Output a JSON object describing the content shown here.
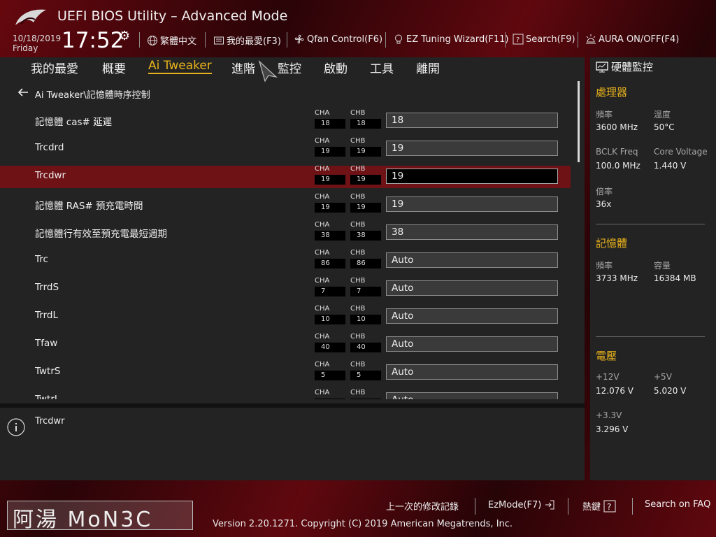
{
  "header": {
    "title": "UEFI BIOS Utility – Advanced Mode",
    "date": "10/18/2019",
    "day": "Friday",
    "time": "17:52",
    "toolbar": {
      "language": "繁體中文",
      "favorites": "我的最愛(F3)",
      "qfan": "Qfan Control(F6)",
      "ez_tuning": "EZ Tuning Wizard(F11)",
      "search": "Search(F9)",
      "aura": "AURA ON/OFF(F4)"
    }
  },
  "tabs": [
    "我的最愛",
    "概要",
    "Ai Tweaker",
    "進階",
    "監控",
    "啟動",
    "工具",
    "離開"
  ],
  "active_tab": "Ai Tweaker",
  "breadcrumb": "Ai Tweaker\\記憶體時序控制",
  "channel_labels": {
    "a": "CHA",
    "b": "CHB"
  },
  "settings": [
    {
      "label": "記憶體 cas# 延遲",
      "cha": "18",
      "chb": "18",
      "value": "18"
    },
    {
      "label": "Trcdrd",
      "cha": "19",
      "chb": "19",
      "value": "19"
    },
    {
      "label": "Trcdwr",
      "cha": "19",
      "chb": "19",
      "value": "19"
    },
    {
      "label": "記憶體 RAS# 預充電時間",
      "cha": "19",
      "chb": "19",
      "value": "19"
    },
    {
      "label": "記憶體行有效至預充電最短週期",
      "cha": "38",
      "chb": "38",
      "value": "38"
    },
    {
      "label": "Trc",
      "cha": "86",
      "chb": "86",
      "value": "Auto"
    },
    {
      "label": "TrrdS",
      "cha": "7",
      "chb": "7",
      "value": "Auto"
    },
    {
      "label": "TrrdL",
      "cha": "10",
      "chb": "10",
      "value": "Auto"
    },
    {
      "label": "Tfaw",
      "cha": "40",
      "chb": "40",
      "value": "Auto"
    },
    {
      "label": "TwtrS",
      "cha": "5",
      "chb": "5",
      "value": "Auto"
    },
    {
      "label": "TwtrL",
      "cha": "",
      "chb": "",
      "value": "Auto"
    }
  ],
  "selected_setting": "Trcdwr",
  "help_text": "Trcdwr",
  "hardware_monitor": {
    "title": "硬體監控",
    "cpu": {
      "title": "處理器",
      "freq_label": "頻率",
      "freq": "3600 MHz",
      "temp_label": "溫度",
      "temp": "50°C",
      "bclk_label": "BCLK Freq",
      "bclk": "100.0 MHz",
      "voltage_label": "Core Voltage",
      "voltage": "1.440 V",
      "ratio_label": "倍率",
      "ratio": "36x"
    },
    "memory": {
      "title": "記憶體",
      "freq_label": "頻率",
      "freq": "3733 MHz",
      "cap_label": "容量",
      "cap": "16384 MB"
    },
    "voltage": {
      "title": "電壓",
      "v12_label": "+12V",
      "v12": "12.076 V",
      "v5_label": "+5V",
      "v5": "5.020 V",
      "v33_label": "+3.3V",
      "v33": "3.296 V"
    }
  },
  "footer": {
    "last_modified": "上一次的修改記錄",
    "ezmode": "EzMode(F7)",
    "hotkeys": "熱鍵",
    "faq": "Search on FAQ",
    "version": "Version 2.20.1271. Copyright (C) 2019 American Megatrends, Inc.",
    "watermark": "阿湯 MoN3C"
  },
  "colors": {
    "accent": "#e8b21c",
    "selected_row": "#6e1216"
  }
}
